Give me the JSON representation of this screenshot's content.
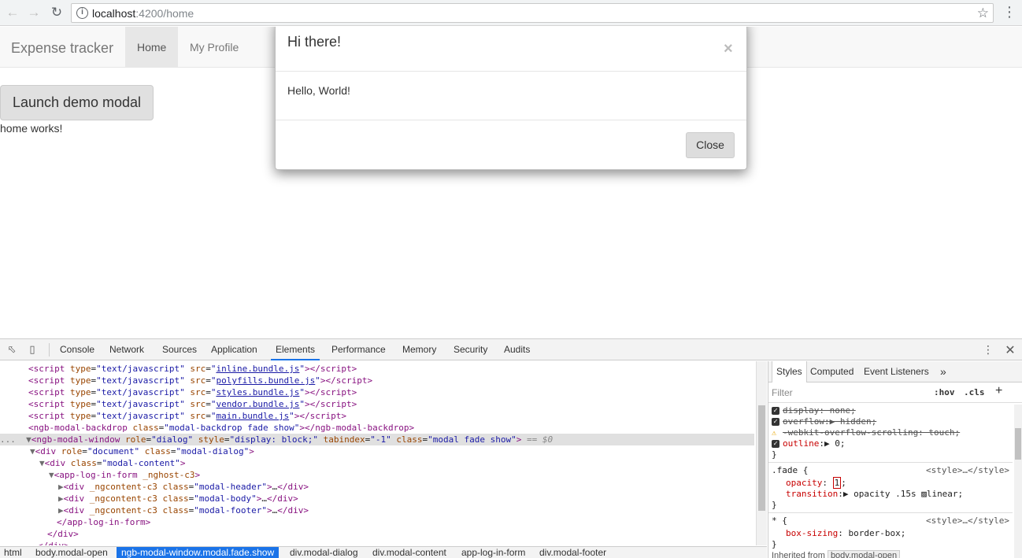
{
  "browser": {
    "url_host": "localhost",
    "url_path": ":4200/home",
    "back_icon": "arrow-left",
    "forward_icon": "arrow-right",
    "reload_icon": "reload",
    "star_icon": "star",
    "menu_icon": "kebab"
  },
  "app": {
    "brand": "Expense tracker",
    "nav": [
      "Home",
      "My Profile"
    ],
    "launch_button": "Launch demo modal",
    "body_text": "home works!"
  },
  "modal": {
    "title": "Hi there!",
    "close_symbol": "×",
    "body": "Hello, World!",
    "close_button": "Close"
  },
  "devtools": {
    "tabs": [
      "Console",
      "Network",
      "Sources",
      "Application",
      "Elements",
      "Performance",
      "Memory",
      "Security",
      "Audits"
    ],
    "active_tab": "Elements",
    "styles_tabs": [
      "Styles",
      "Computed",
      "Event Listeners"
    ],
    "filter_placeholder": "Filter",
    "hov": ":hov",
    "cls": ".cls",
    "eq": "== $0",
    "crumbs": [
      "html",
      "body.modal-open",
      "ngb-modal-window.modal.fade.show",
      "div.modal-dialog",
      "div.modal-content",
      "app-log-in-form",
      "div.modal-footer"
    ],
    "scripts": [
      "inline.bundle.js",
      "polyfills.bundle.js",
      "styles.bundle.js",
      "vendor.bundle.js",
      "main.bundle.js"
    ],
    "style_src": "<style>…</style>",
    "inherited": "Inherited from",
    "inherited_from": "body.modal-open",
    "modal_headers": [
      "modal-header",
      "modal-body",
      "modal-footer"
    ]
  }
}
